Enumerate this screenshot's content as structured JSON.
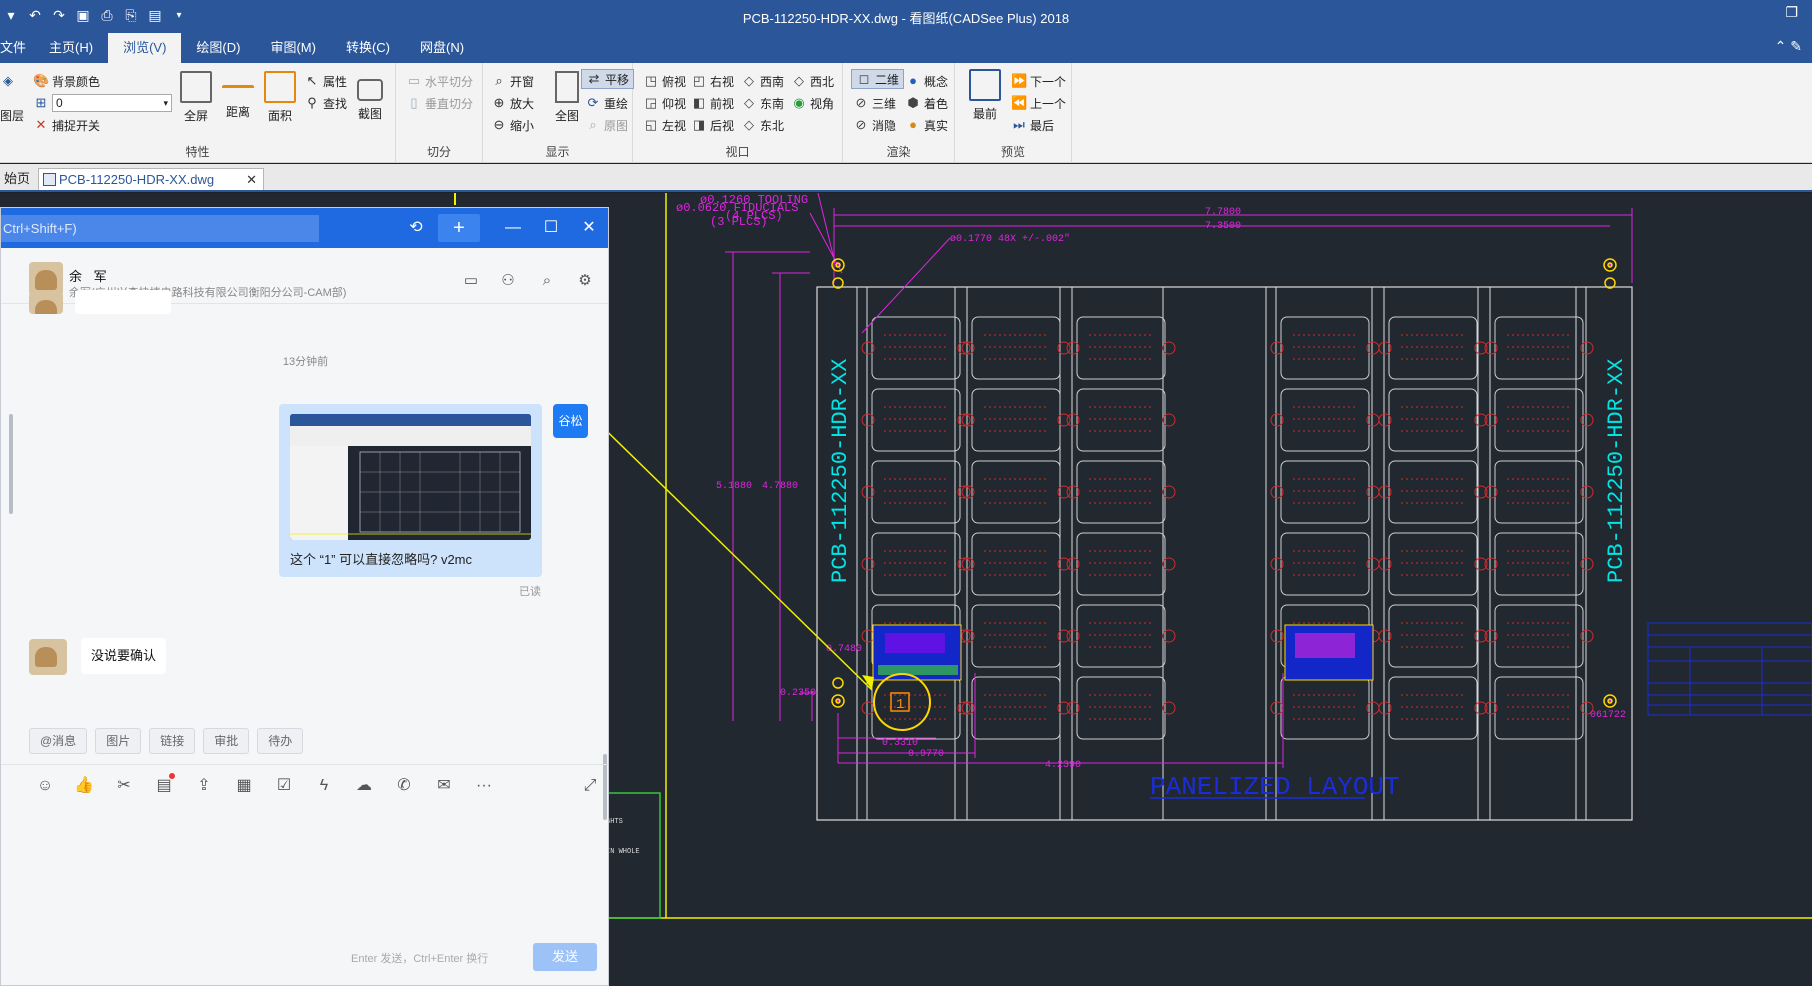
{
  "app": {
    "title": "PCB-112250-HDR-XX.dwg - 看图纸(CADSee Plus) 2018"
  },
  "menu": {
    "tabs": [
      "文件",
      "主页(H)",
      "浏览(V)",
      "绘图(D)",
      "审图(M)",
      "转换(C)",
      "网盘(N)"
    ],
    "active_index": 2
  },
  "ribbon": {
    "groups": {
      "properties": {
        "label": "特性",
        "layer": "图层",
        "bg_color": "背景颜色",
        "layer_value": "0",
        "snap": "捕捉开关",
        "fullscreen": "全屏",
        "distance": "距离",
        "area": "面积",
        "attribute": "属性",
        "find": "查找",
        "screenshot": "截图"
      },
      "split": {
        "label": "切分",
        "horizontal": "水平切分",
        "vertical": "垂直切分"
      },
      "display": {
        "label": "显示",
        "window": "开窗",
        "zoom_in": "放大",
        "zoom_out": "缩小",
        "whole": "全图",
        "pan": "平移",
        "redraw": "重绘",
        "original": "原图"
      },
      "viewport": {
        "label": "视口",
        "top": "俯视",
        "bottom": "仰视",
        "left": "左视",
        "right": "右视",
        "front": "前视",
        "back": "后视",
        "sw": "西南",
        "se": "东南",
        "ne": "东北",
        "nw": "西北",
        "view_angle": "视角"
      },
      "render": {
        "label": "渲染",
        "2d": "二维",
        "3d": "三维",
        "hide": "消隐",
        "concept": "概念",
        "shade": "着色",
        "realistic": "真实"
      },
      "preview": {
        "label": "预览",
        "front": "最前",
        "next": "下一个",
        "prev": "上一个",
        "last": "最后"
      }
    }
  },
  "doc_tabs": {
    "home": "始页",
    "file": "PCB-112250-HDR-XX.dwg"
  },
  "drawing": {
    "tooling": "ø0.1260 TOOLING",
    "tooling_count": "(4 PLCS)",
    "fiducials": "ø0.0620 FIDUCIALS",
    "fiducials_count": "(3 PLCS)",
    "holes": "ø0.1770 48X +/-.002\"",
    "width_total": "7.7800",
    "width_inner": "7.3500",
    "height_total": "5.1880",
    "height_inner": "4.7880",
    "dim_0750": "0.7480",
    "dim_2350": "0.2350",
    "dim_3310": "0.3310",
    "dim_9770": "0.9770",
    "dim_4230": "4.2390",
    "label_left": "PCB-112250-HDR-XX",
    "label_right": "PCB-112250-HDR-XX",
    "marker": "1",
    "title": "PANELIZED LAYOUT",
    "code": "061722"
  },
  "chat": {
    "search_placeholder": "Ctrl+Shift+F)",
    "contact_name": "余 军",
    "contact_org": "余军(广州兴森快捷电路科技有限公司衡阳分公司-CAM部)",
    "timestamp": "13分钟前",
    "my_message": "这个 “1” 可以直接忽略吗? v2mc",
    "my_avatar": "谷松",
    "read_status": "已读",
    "reply": "没说要确认",
    "quick_actions": [
      "@消息",
      "图片",
      "链接",
      "审批",
      "待办"
    ],
    "input_hint": "Enter 发送，Ctrl+Enter 换行",
    "send": "发送"
  }
}
